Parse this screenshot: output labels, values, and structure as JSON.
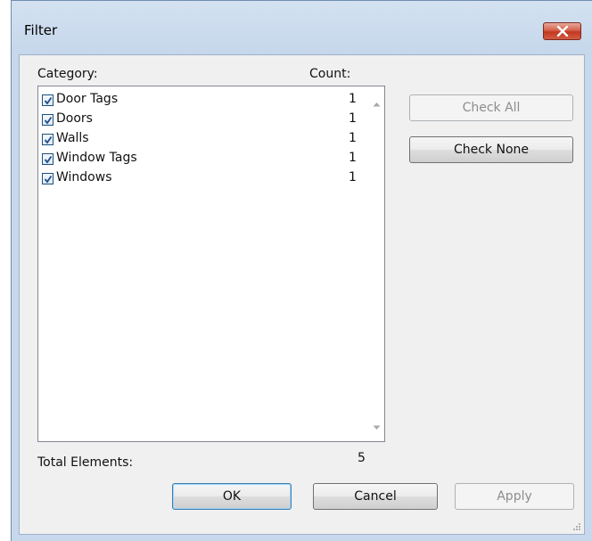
{
  "window": {
    "title": "Filter"
  },
  "labels": {
    "category": "Category:",
    "count": "Count:",
    "total_elements": "Total Elements:",
    "total_value": "5"
  },
  "categories": [
    {
      "name": "Door Tags",
      "count": "1",
      "checked": true
    },
    {
      "name": "Doors",
      "count": "1",
      "checked": true
    },
    {
      "name": "Walls",
      "count": "1",
      "checked": true
    },
    {
      "name": "Window Tags",
      "count": "1",
      "checked": true
    },
    {
      "name": "Windows",
      "count": "1",
      "checked": true
    }
  ],
  "buttons": {
    "check_all": "Check All",
    "check_none": "Check None",
    "ok": "OK",
    "cancel": "Cancel",
    "apply": "Apply"
  },
  "colors": {
    "title_bar": "#c6d7eb",
    "close_button": "#c1381f",
    "checkbox_border": "#1c5180",
    "dialog_background": "#f0f0f0"
  }
}
